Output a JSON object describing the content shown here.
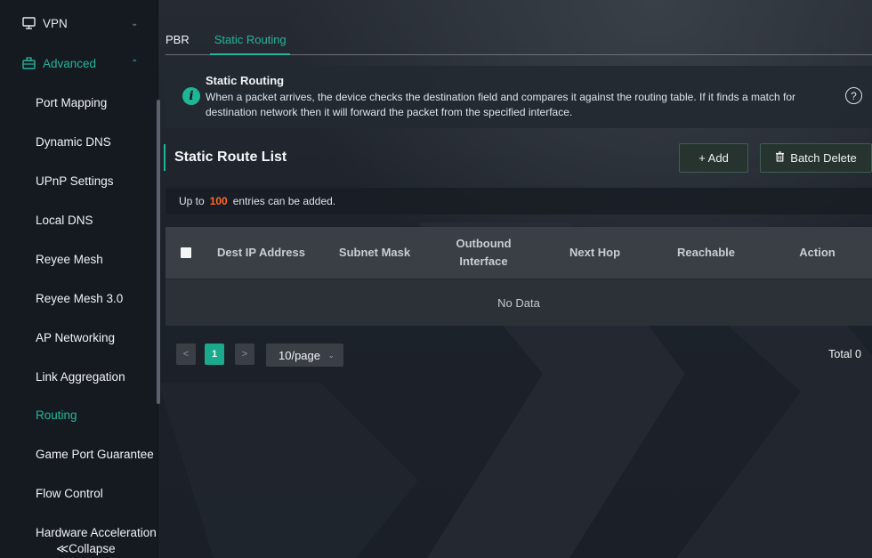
{
  "sidebar": {
    "vpn_label": "VPN",
    "advanced_label": "Advanced",
    "items": [
      {
        "label": "Port Mapping"
      },
      {
        "label": "Dynamic DNS"
      },
      {
        "label": "UPnP Settings"
      },
      {
        "label": "Local DNS"
      },
      {
        "label": "Reyee Mesh"
      },
      {
        "label": "Reyee Mesh 3.0"
      },
      {
        "label": "AP Networking"
      },
      {
        "label": "Link Aggregation"
      },
      {
        "label": "Routing"
      },
      {
        "label": "Game Port Guarantee"
      },
      {
        "label": "Flow Control"
      },
      {
        "label": "Hardware Acceleration"
      }
    ],
    "active_item": "Routing",
    "collapse_label": "≪Collapse"
  },
  "tabs": [
    {
      "label": "PBR"
    },
    {
      "label": "Static Routing"
    }
  ],
  "active_tab": "Static Routing",
  "info": {
    "title": "Static Routing",
    "text": "When a packet arrives, the device checks the destination field and compares it against the routing table. If it finds a match for destination network then it will forward the packet from the specified interface."
  },
  "list": {
    "title": "Static Route List",
    "add_label": "+ Add",
    "batch_delete_label": "Batch Delete"
  },
  "limit": {
    "prefix": "Up to",
    "count": "100",
    "suffix": "entries can be added."
  },
  "table": {
    "columns": [
      "Dest IP Address",
      "Subnet Mask",
      "Outbound Interface",
      "Next Hop",
      "Reachable",
      "Action"
    ],
    "empty_text": "No Data"
  },
  "pagination": {
    "prev": "<",
    "current_page": "1",
    "next": ">",
    "page_size": "10/page",
    "total": "Total 0"
  },
  "colors": {
    "accent": "#22b59a",
    "highlight_number": "#ff6a2b"
  }
}
